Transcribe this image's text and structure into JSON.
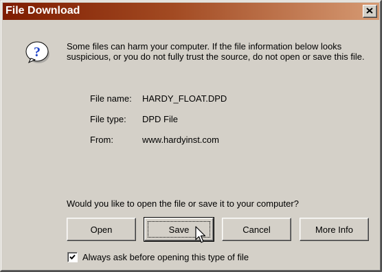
{
  "window": {
    "title": "File Download",
    "close_label": "Close"
  },
  "message": "Some files can harm your computer. If the file information below looks suspicious, or you do not fully trust the source, do not open or save this file.",
  "file_info": {
    "name_label": "File name:",
    "name_value": "HARDY_FLOAT.DPD",
    "type_label": "File type:",
    "type_value": "DPD File",
    "from_label": "From:",
    "from_value": "www.hardyinst.com"
  },
  "question": "Would you like to open the file or save it to your computer?",
  "buttons": {
    "open": "Open",
    "save": "Save",
    "cancel": "Cancel",
    "more_info": "More Info"
  },
  "checkbox": {
    "label": "Always ask before opening this type of file",
    "checked": true
  },
  "colors": {
    "title_start": "#7e1c00",
    "title_end": "#d69a73",
    "dialog_bg": "#d4d0c8",
    "icon_blue": "#1f44c9"
  },
  "icons": [
    "question-icon",
    "close-icon",
    "checkmark-icon",
    "mouse-cursor-icon"
  ]
}
